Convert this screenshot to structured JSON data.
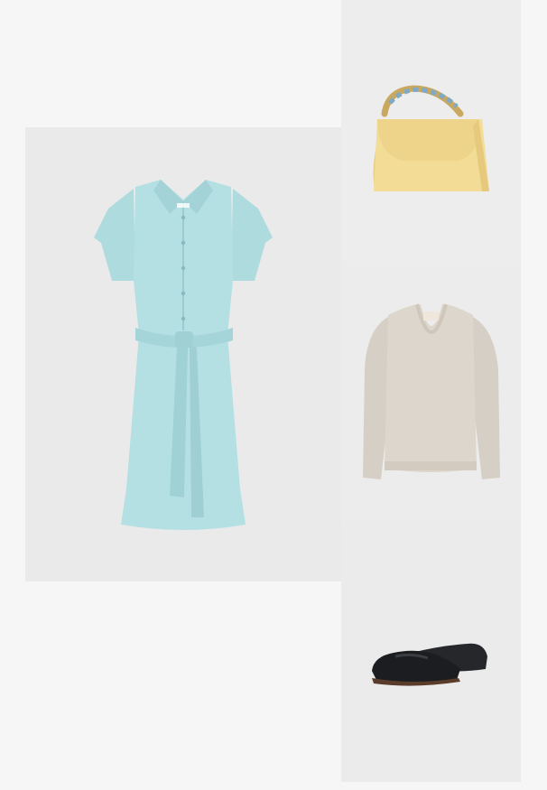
{
  "outfit": {
    "items": [
      {
        "name": "shirt-dress",
        "color": "#b5e0e3"
      },
      {
        "name": "handbag",
        "color": "#f2dc96"
      },
      {
        "name": "sweater",
        "color": "#ddd6cc"
      },
      {
        "name": "loafer",
        "color": "#1b1d20"
      }
    ]
  }
}
